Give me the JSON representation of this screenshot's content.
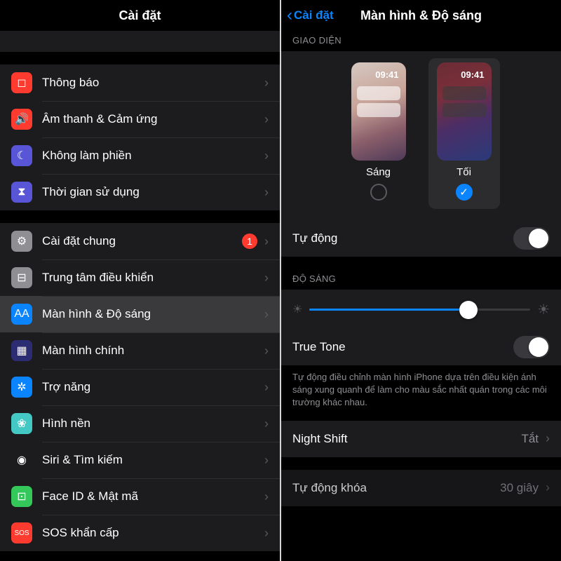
{
  "left": {
    "title": "Cài đặt",
    "top_row": {
      "label": "",
      "trail": ""
    },
    "group1": [
      {
        "icon": "notify-icon",
        "bg": "#ff3b30",
        "glyph": "◻",
        "label": "Thông báo"
      },
      {
        "icon": "sound-icon",
        "bg": "#ff3b30",
        "glyph": "🔊",
        "label": "Âm thanh & Cảm ứng"
      },
      {
        "icon": "dnd-icon",
        "bg": "#5856d6",
        "glyph": "☾",
        "label": "Không làm phiền"
      },
      {
        "icon": "screentime-icon",
        "bg": "#5856d6",
        "glyph": "⧗",
        "label": "Thời gian sử dụng"
      }
    ],
    "group2": [
      {
        "icon": "general-icon",
        "bg": "#8e8e93",
        "glyph": "⚙",
        "label": "Cài đặt chung",
        "badge": "1"
      },
      {
        "icon": "control-center-icon",
        "bg": "#8e8e93",
        "glyph": "⊟",
        "label": "Trung tâm điều khiển"
      },
      {
        "icon": "display-icon",
        "bg": "#0a84ff",
        "glyph": "AA",
        "label": "Màn hình & Độ sáng",
        "selected": true
      },
      {
        "icon": "homescreen-icon",
        "bg": "#2c2c72",
        "glyph": "▦",
        "label": "Màn hình chính"
      },
      {
        "icon": "accessibility-icon",
        "bg": "#0a84ff",
        "glyph": "✲",
        "label": "Trợ năng"
      },
      {
        "icon": "wallpaper-icon",
        "bg": "#44c8c4",
        "glyph": "❀",
        "label": "Hình nền"
      },
      {
        "icon": "siri-icon",
        "bg": "#1c1c1e",
        "glyph": "◉",
        "label": "Siri & Tìm kiếm"
      },
      {
        "icon": "faceid-icon",
        "bg": "#34c759",
        "glyph": "⊡",
        "label": "Face ID & Mật mã"
      },
      {
        "icon": "sos-icon",
        "bg": "#ff3b30",
        "glyph": "SOS",
        "label": "SOS khẩn cấp"
      }
    ]
  },
  "right": {
    "back": "Cài đặt",
    "title": "Màn hình & Độ sáng",
    "section_appearance": "GIAO DIỆN",
    "thumb_time": "09:41",
    "option_light": "Sáng",
    "option_dark": "Tối",
    "selected_option": "dark",
    "auto_label": "Tự động",
    "auto_on": false,
    "section_brightness": "ĐỘ SÁNG",
    "brightness_pct": 72,
    "truetone_label": "True Tone",
    "truetone_on": false,
    "truetone_note": "Tự động điều chỉnh màn hình iPhone dựa trên điều kiện ánh sáng xung quanh để làm cho màu sắc nhất quán trong các môi trường khác nhau.",
    "nightshift_label": "Night Shift",
    "nightshift_value": "Tắt",
    "autolock_label": "Tự động khóa",
    "autolock_value": "30 giây"
  }
}
